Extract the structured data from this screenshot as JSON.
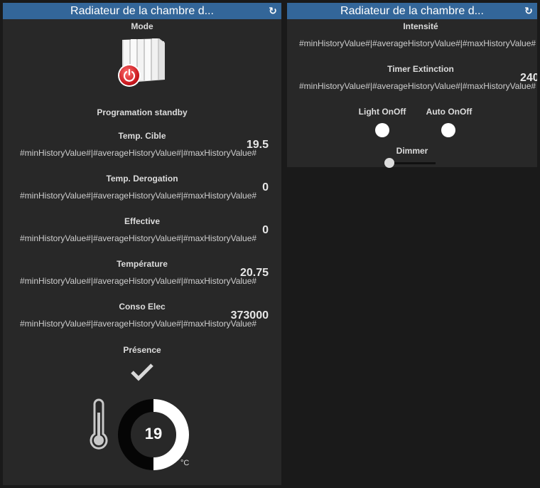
{
  "left_panel": {
    "title": "Radiateur de la chambre d...",
    "mode_label": "Mode",
    "program_label": "Programation standby",
    "metrics": [
      {
        "label": "Temp. Cible",
        "history": "#minHistoryValue#|#averageHistoryValue#|#maxHistoryValue#",
        "value": "19.5"
      },
      {
        "label": "Temp. Derogation",
        "history": "#minHistoryValue#|#averageHistoryValue#|#maxHistoryValue#",
        "value": "0"
      },
      {
        "label": "Effective",
        "history": "#minHistoryValue#|#averageHistoryValue#|#maxHistoryValue#",
        "value": "0"
      },
      {
        "label": "Température",
        "history": "#minHistoryValue#|#averageHistoryValue#|#maxHistoryValue#",
        "value": "20.75"
      },
      {
        "label": "Conso Elec",
        "history": "#minHistoryValue#|#averageHistoryValue#|#maxHistoryValue#",
        "value": "373000"
      }
    ],
    "presence_label": "Présence",
    "thermostat": {
      "value": "19",
      "unit": "°C",
      "level": 0.5
    }
  },
  "right_panel": {
    "title": "Radiateur de la chambre d...",
    "intensite_label": "Intensité",
    "intensite_history": "#minHistoryValue#|#averageHistoryValue#|#maxHistoryValue#",
    "timer_label": "Timer Extinction",
    "timer_history": "#minHistoryValue#|#averageHistoryValue#|#maxHistoryValue#",
    "timer_value": "240",
    "light_label": "Light OnOff",
    "auto_label": "Auto OnOff",
    "dimmer_label": "Dimmer",
    "dimmer_level": 0
  },
  "colors": {
    "header": "#336699",
    "panel": "#282828",
    "background": "#1a1a1a",
    "power_button": "#d9262c"
  },
  "icons": [
    "refresh-icon",
    "radiator-icon",
    "power-icon",
    "check-icon",
    "thermometer-icon"
  ]
}
